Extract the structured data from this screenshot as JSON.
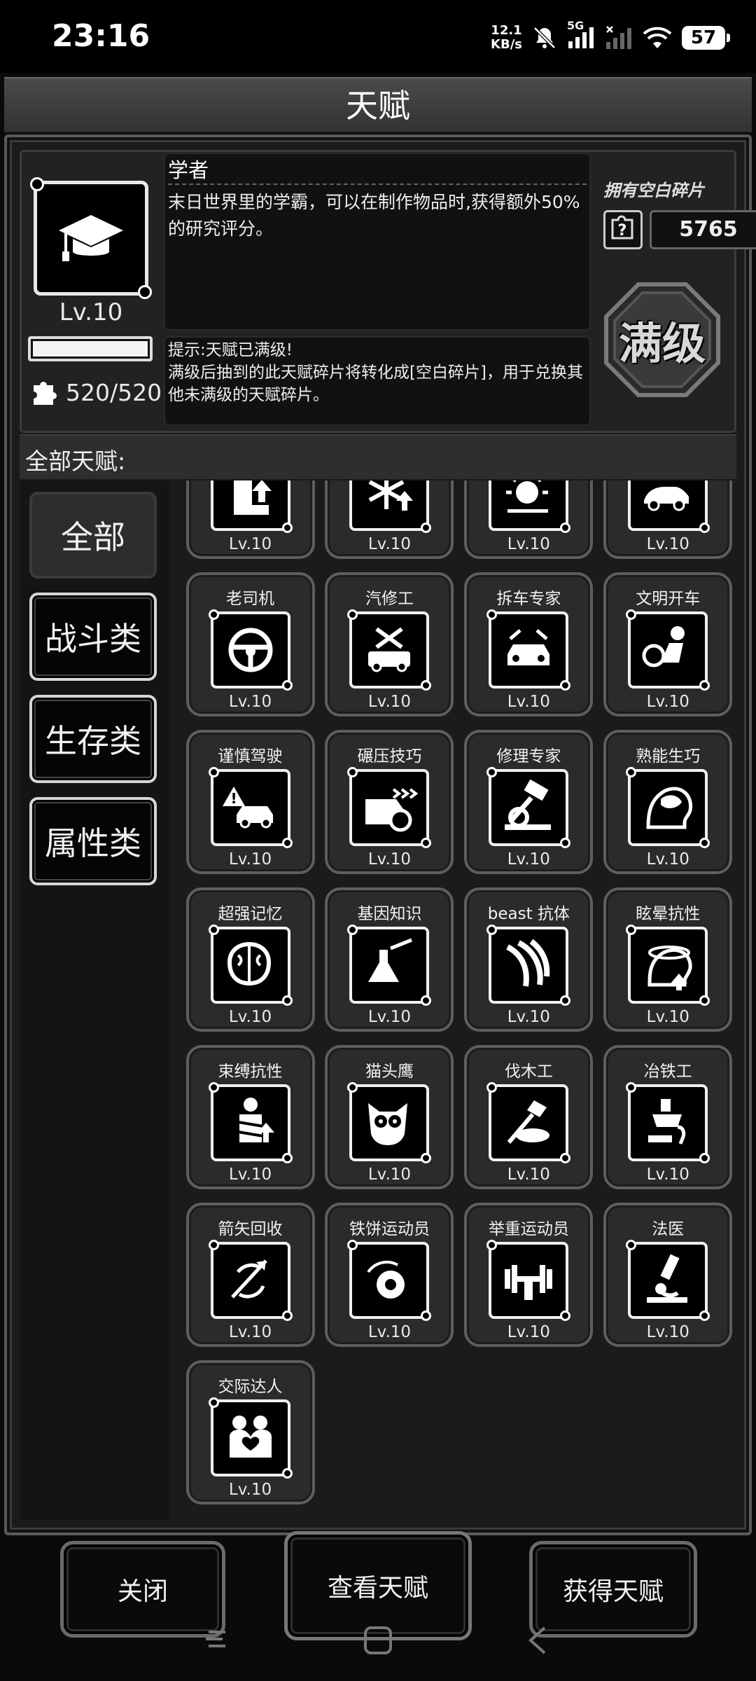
{
  "status": {
    "time": "23:16",
    "net_speed_top": "12.1",
    "net_speed_bottom": "KB/s",
    "network": "5G",
    "battery": "57"
  },
  "title": "天赋",
  "selected": {
    "name": "学者",
    "level": "Lv.10",
    "description": "末日世界里的学霸，可以在制作物品时,获得额外50%的研究评分。",
    "hint": "提示:天赋已满级!\n满级后抽到的此天赋碎片将转化成[空白碎片]，用于兑换其他未满级的天赋碎片。",
    "fragments": "520/520",
    "fragment_progress": 1.0,
    "icon": "graduation-cap-icon"
  },
  "blank_shards": {
    "label": "拥有空白碎片",
    "value": "5765"
  },
  "max_level_badge": "满级",
  "all_talents_label": "全部天赋:",
  "categories": [
    {
      "label": "全部",
      "active": true
    },
    {
      "label": "战斗类",
      "active": false
    },
    {
      "label": "生存类",
      "active": false
    },
    {
      "label": "属性类",
      "active": false
    }
  ],
  "talents": [
    {
      "name": "",
      "level": "Lv.10",
      "icon": "foot-up-icon"
    },
    {
      "name": "",
      "level": "Lv.10",
      "icon": "snowflake-up-icon"
    },
    {
      "name": "",
      "level": "Lv.10",
      "icon": "sun-up-icon"
    },
    {
      "name": "",
      "level": "Lv.10",
      "icon": "sports-car-icon"
    },
    {
      "name": "老司机",
      "level": "Lv.10",
      "icon": "steering-wheel-icon"
    },
    {
      "name": "汽修工",
      "level": "Lv.10",
      "icon": "car-repair-icon"
    },
    {
      "name": "拆车专家",
      "level": "Lv.10",
      "icon": "car-dismantle-icon"
    },
    {
      "name": "文明开车",
      "level": "Lv.10",
      "icon": "seated-driver-icon"
    },
    {
      "name": "谨慎驾驶",
      "level": "Lv.10",
      "icon": "warning-car-icon"
    },
    {
      "name": "碾压技巧",
      "level": "Lv.10",
      "icon": "car-crush-icon"
    },
    {
      "name": "修理专家",
      "level": "Lv.10",
      "icon": "hammer-gear-icon"
    },
    {
      "name": "熟能生巧",
      "level": "Lv.10",
      "icon": "head-brain-icon"
    },
    {
      "name": "超强记忆",
      "level": "Lv.10",
      "icon": "brain-icon"
    },
    {
      "name": "基因知识",
      "level": "Lv.10",
      "icon": "flask-icon"
    },
    {
      "name": "beast 抗体",
      "level": "Lv.10",
      "icon": "claw-scratch-icon"
    },
    {
      "name": "眩晕抗性",
      "level": "Lv.10",
      "icon": "dizzy-head-icon"
    },
    {
      "name": "束缚抗性",
      "level": "Lv.10",
      "icon": "bound-person-icon"
    },
    {
      "name": "猫头鹰",
      "level": "Lv.10",
      "icon": "owl-icon"
    },
    {
      "name": "伐木工",
      "level": "Lv.10",
      "icon": "axe-log-icon"
    },
    {
      "name": "冶铁工",
      "level": "Lv.10",
      "icon": "crucible-icon"
    },
    {
      "name": "箭矢回收",
      "level": "Lv.10",
      "icon": "arrow-recycle-icon"
    },
    {
      "name": "铁饼运动员",
      "level": "Lv.10",
      "icon": "discus-icon"
    },
    {
      "name": "举重运动员",
      "level": "Lv.10",
      "icon": "barbell-icon"
    },
    {
      "name": "法医",
      "level": "Lv.10",
      "icon": "microscope-icon"
    },
    {
      "name": "交际达人",
      "level": "Lv.10",
      "icon": "hug-heart-icon"
    }
  ],
  "buttons": {
    "close": "关闭",
    "view": "查看天赋",
    "get": "获得天赋"
  }
}
